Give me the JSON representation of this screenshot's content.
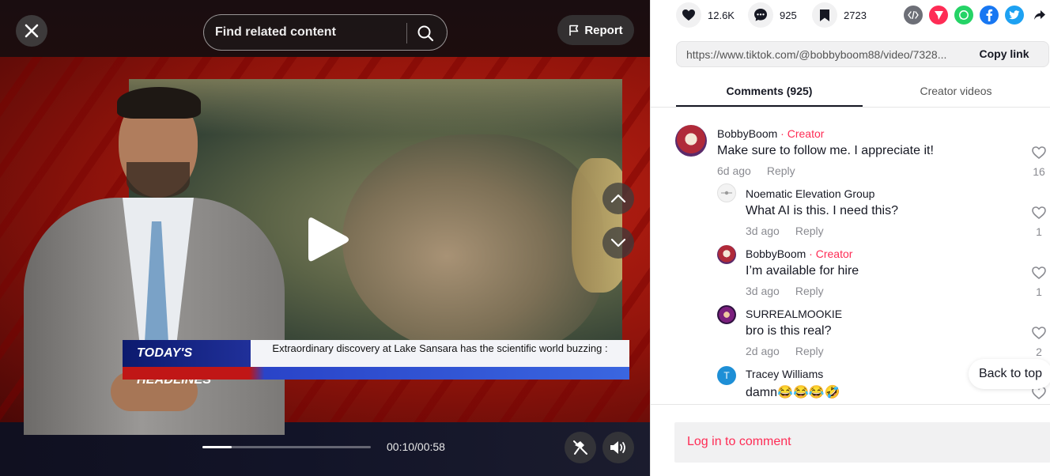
{
  "player": {
    "search": {
      "placeholder": "Find related content"
    },
    "report_label": "Report",
    "ticker": {
      "tag": "TODAY'S HEADLINES",
      "message": "Extraordinary discovery at Lake Sansara has the scientific world buzzing :"
    },
    "time": "00:10/00:58",
    "progress_fraction": 0.172
  },
  "actions": {
    "likes": "12.6K",
    "comments": "925",
    "saves": "2723"
  },
  "share": {
    "url": "https://www.tiktok.com/@bobbyboom88/video/7328...",
    "copy_label": "Copy link"
  },
  "tabs": [
    {
      "label": "Comments (925)",
      "active": true
    },
    {
      "label": "Creator videos",
      "active": false
    }
  ],
  "comments": [
    {
      "user": "BobbyBoom",
      "creator_label": "· Creator",
      "text": "Make sure to follow me. I appreciate it!",
      "time": "6d ago",
      "reply": "Reply",
      "likes": "16"
    },
    {
      "user": "Noematic Elevation Group",
      "creator_label": "",
      "text": "What AI is this. I need this?",
      "time": "3d ago",
      "reply": "Reply",
      "likes": "1"
    },
    {
      "user": "BobbyBoom",
      "creator_label": "· Creator",
      "text": "I’m available for hire",
      "time": "3d ago",
      "reply": "Reply",
      "likes": "1"
    },
    {
      "user": "SURREALMOOKIE",
      "creator_label": "",
      "text": "bro is this real?",
      "time": "2d ago",
      "reply": "Reply",
      "likes": "2"
    },
    {
      "user": "Tracey Williams",
      "creator_label": "",
      "text": "damn😂😂😂🤣",
      "avatar_letter": "T"
    }
  ],
  "back_to_top": "Back to top",
  "login_prompt": "Log in to comment",
  "colors": {
    "accent": "#fe2c55",
    "text": "#161823",
    "muted": "#8a8b91"
  }
}
